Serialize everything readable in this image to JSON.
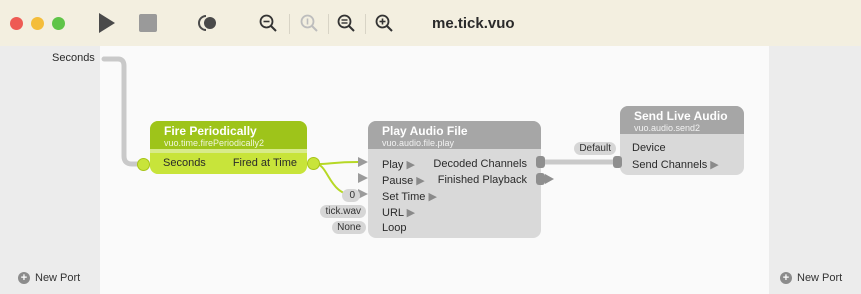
{
  "window": {
    "title": "me.tick.vuo",
    "traffic_lights": {
      "close": "#ee5b54",
      "minimize": "#f4bd3a",
      "zoom": "#5fc448"
    }
  },
  "toolbar": {
    "icons": [
      "play-icon",
      "stop-icon",
      "record-icon",
      "zoom-out-icon",
      "zoom-actual-icon",
      "zoom-fit-icon",
      "zoom-in-icon"
    ]
  },
  "published_inputs": {
    "ports": [
      {
        "label": "Seconds"
      }
    ],
    "new_port_label": "New Port"
  },
  "published_outputs": {
    "new_port_label": "New Port"
  },
  "nodes": {
    "fire_periodically": {
      "title": "Fire Periodically",
      "class_name": "vuo.time.firePeriodically2",
      "input_label": "Seconds",
      "output_label": "Fired at Time",
      "color": "#9ec41a"
    },
    "play_audio_file": {
      "title": "Play Audio File",
      "class_name": "vuo.audio.file.play",
      "inputs": [
        "Play",
        "Pause",
        "Set Time",
        "URL",
        "Loop"
      ],
      "outputs": [
        "Decoded Channels",
        "Finished Playback"
      ],
      "constants": {
        "set_time": "0",
        "url": "tick.wav",
        "loop": "None"
      },
      "color": "#a6a6a6"
    },
    "send_live_audio": {
      "title": "Send Live Audio",
      "class_name": "vuo.audio.send2",
      "inputs": [
        "Device",
        "Send Channels"
      ],
      "constants": {
        "device": "Default"
      },
      "color": "#a6a6a6"
    }
  }
}
